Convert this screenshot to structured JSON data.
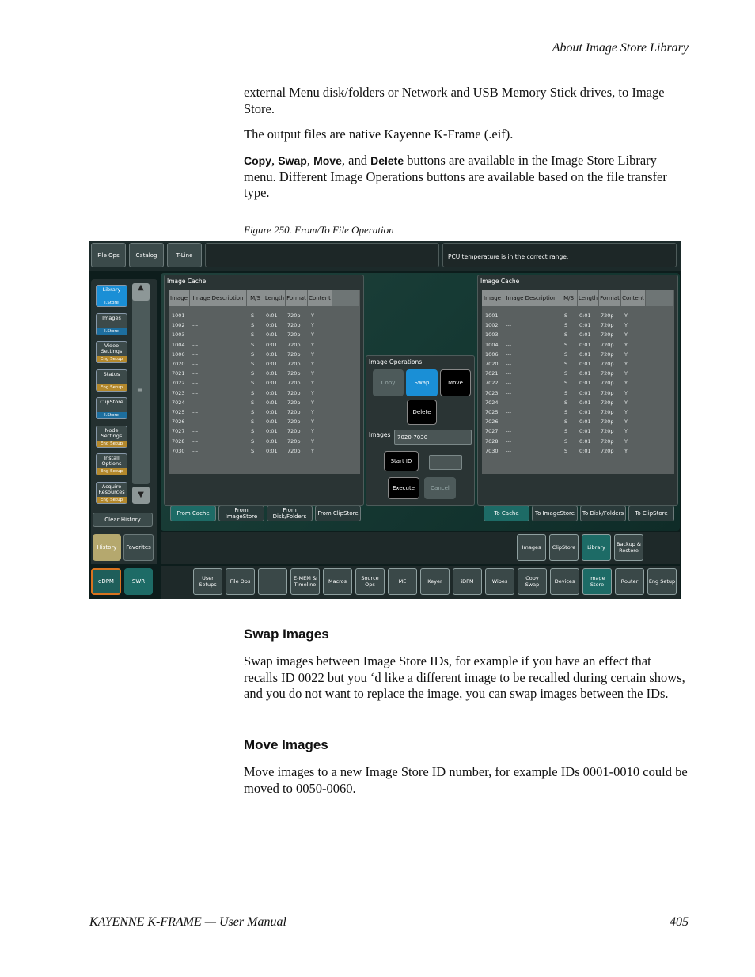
{
  "header": {
    "running_head": "About Image Store Library"
  },
  "body": {
    "para1": "external Menu disk/folders or Network and USB Memory Stick drives, to Image Store.",
    "para2": "The output files are native Kayenne K-Frame (.eif).",
    "para3": {
      "copy": "Copy",
      "sep1": ", ",
      "swap": "Swap",
      "sep2": ", ",
      "move": "Move",
      "sep3": ", and ",
      "delete": "Delete",
      "rest": " buttons are available in the Image Store Library menu. Different Image Operations buttons are available based on the file transfer type."
    },
    "figure_caption": "Figure 250.  From/To File Operation",
    "swap_heading": "Swap Images",
    "swap_text": "Swap images between Image Store IDs, for example if you have an effect that recalls ID 0022 but you ‘d like a different image to be recalled during certain shows, and you do not want to replace the image, you can swap images between the IDs.",
    "move_heading": "Move Images",
    "move_text": "Move images to a new Image Store ID number, for example IDs 0001-0010 could be moved to 0050-0060."
  },
  "footer": {
    "left": "KAYENNE K-FRAME  —  User Manual",
    "page": "405"
  },
  "screen": {
    "top_tabs": [
      "File Ops",
      "Catalog",
      "T-Line"
    ],
    "status": "PCU temperature is in the correct range.",
    "sidebar": [
      {
        "label": "Library",
        "tag": "I.Store"
      },
      {
        "label": "Images",
        "tag": "I.Store"
      },
      {
        "label": "Video Settings",
        "tag": "Eng  Setup"
      },
      {
        "label": "Status",
        "tag": "Eng  Setup"
      },
      {
        "label": "ClipStore",
        "tag": "I.Store"
      },
      {
        "label": "Node Settings",
        "tag": "Eng  Setup"
      },
      {
        "label": "Install Options",
        "tag": "Eng  Setup"
      },
      {
        "label": "Acquire Resources",
        "tag": "Eng  Setup"
      }
    ],
    "clear_history": "Clear History",
    "history": "History",
    "favorites": "Favorites",
    "edpm": "eDPM",
    "swr": "SWR",
    "cache_title": "Image Cache",
    "columns": [
      "Image",
      "Image Description",
      "M/S",
      "Length",
      "Format",
      "Content"
    ],
    "rows": [
      [
        "1001",
        "---",
        "S",
        "0:01",
        "720p",
        "Y"
      ],
      [
        "1002",
        "---",
        "S",
        "0:01",
        "720p",
        "Y"
      ],
      [
        "1003",
        "---",
        "S",
        "0:01",
        "720p",
        "Y"
      ],
      [
        "1004",
        "---",
        "S",
        "0:01",
        "720p",
        "Y"
      ],
      [
        "1006",
        "---",
        "S",
        "0:01",
        "720p",
        "Y"
      ],
      [
        "7020",
        "---",
        "S",
        "0:01",
        "720p",
        "Y"
      ],
      [
        "7021",
        "---",
        "S",
        "0:01",
        "720p",
        "Y"
      ],
      [
        "7022",
        "---",
        "S",
        "0:01",
        "720p",
        "Y"
      ],
      [
        "7023",
        "---",
        "S",
        "0:01",
        "720p",
        "Y"
      ],
      [
        "7024",
        "---",
        "S",
        "0:01",
        "720p",
        "Y"
      ],
      [
        "7025",
        "---",
        "S",
        "0:01",
        "720p",
        "Y"
      ],
      [
        "7026",
        "---",
        "S",
        "0:01",
        "720p",
        "Y"
      ],
      [
        "7027",
        "---",
        "S",
        "0:01",
        "720p",
        "Y"
      ],
      [
        "7028",
        "---",
        "S",
        "0:01",
        "720p",
        "Y"
      ],
      [
        "7030",
        "---",
        "S",
        "0:01",
        "720p",
        "Y"
      ]
    ],
    "from_tabs": [
      "From Cache",
      "From ImageStore",
      "From Disk/Folders",
      "From ClipStore"
    ],
    "to_tabs": [
      "To Cache",
      "To ImageStore",
      "To Disk/Folders",
      "To ClipStore"
    ],
    "ops_title": "Image Operations",
    "ops": {
      "copy": "Copy",
      "swap": "Swap",
      "move": "Move",
      "delete": "Delete"
    },
    "images_label": "Images",
    "images_value": "7020-7030",
    "start_id": "Start ID",
    "execute": "Execute",
    "cancel": "Cancel",
    "sub_tabs": [
      "Images",
      "ClipStore",
      "Library",
      "Backup & Restore"
    ],
    "bottom_nav": [
      "User Setups",
      "File Ops",
      "",
      "E-MEM & Timeline",
      "Macros",
      "Source Ops",
      "ME",
      "Keyer",
      "iDPM",
      "Wipes",
      "Copy Swap",
      "Devices",
      "Image Store",
      "Router",
      "Eng Setup"
    ],
    "colors": {
      "active_blue": "#1a8fd6",
      "teal": "#1d6b66",
      "sidebar_tag": "#b3882c",
      "history": "#b5a86e",
      "edpm_border": "#d8731f"
    }
  }
}
